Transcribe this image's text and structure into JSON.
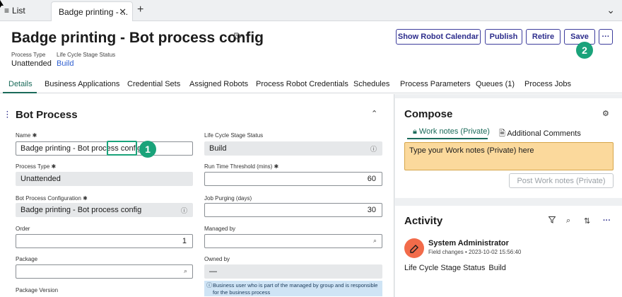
{
  "tabs": {
    "list_label": "List",
    "active_label": "Badge printing - ...",
    "add_label": "+",
    "close_label": "✕",
    "more_label": "⌄"
  },
  "header": {
    "title": "Badge printing - Bot process config",
    "process_type_label": "Process Type",
    "process_type_value": "Unattended",
    "lifecycle_label": "Life Cycle Stage Status",
    "lifecycle_value": "Build"
  },
  "actions": {
    "show_calendar": "Show Robot Calendar",
    "publish": "Publish",
    "retire": "Retire",
    "save": "Save",
    "more": "···"
  },
  "annotations": {
    "one": "1",
    "two": "2"
  },
  "section_tabs": [
    "Details",
    "Business Applications",
    "Credential Sets",
    "Assigned Robots",
    "Process Robot Credentials",
    "Schedules",
    "Process Parameters",
    "Queues (1)",
    "Process Jobs"
  ],
  "form": {
    "section_title": "Bot Process",
    "name_label": "Name ✱",
    "name_value": "Badge printing - Bot process config",
    "lifecycle_label": "Life Cycle Stage Status",
    "lifecycle_value": "Build",
    "process_type_label": "Process Type ✱",
    "process_type_value": "Unattended",
    "runtime_label": "Run Time Threshold (mins) ✱",
    "runtime_value": "60",
    "config_label": "Bot Process Configuration ✱",
    "config_value": "Badge printing - Bot process config",
    "purging_label": "Job Purging (days)",
    "purging_value": "30",
    "order_label": "Order",
    "order_value": "1",
    "managed_label": "Managed by",
    "managed_value": "",
    "package_label": "Package",
    "package_value": "",
    "owned_label": "Owned by",
    "owned_value": "—",
    "package_version_label": "Package Version",
    "owned_info": "Business user who is part of the managed by group and is responsible for the business process"
  },
  "compose": {
    "title": "Compose",
    "tab_work_notes": "Work notes (Private)",
    "tab_comments": "Additional Comments",
    "placeholder": "Type your Work notes (Private) here",
    "post_button": "Post Work notes (Private)"
  },
  "activity": {
    "title": "Activity",
    "user": "System Administrator",
    "meta": "Field changes • 2023-10-02 15:56:40",
    "change_label": "Life Cycle Stage Status",
    "change_value": "Build"
  },
  "colors": {
    "accent": "#1b6b5a",
    "button_border": "#3c3c9c",
    "annotation": "#1aa37a",
    "notes_bg": "#fbd99c",
    "avatar": "#f26b4a"
  }
}
